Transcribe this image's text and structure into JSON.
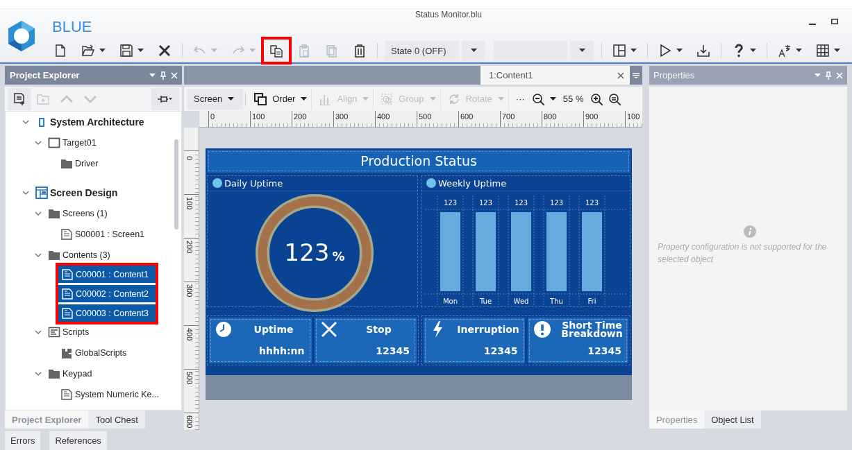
{
  "window": {
    "app_name": "BLUE",
    "title": "Status Monitor.blu"
  },
  "toolbar": [
    [
      {
        "kind": "new",
        "disabled": false,
        "dropdown": false,
        "highlighted": false
      },
      {
        "kind": "open",
        "disabled": false,
        "dropdown": true,
        "highlighted": false
      },
      {
        "kind": "save",
        "disabled": false,
        "dropdown": true,
        "highlighted": false
      },
      {
        "kind": "close",
        "disabled": false,
        "dropdown": false,
        "highlighted": false
      }
    ],
    [
      {
        "kind": "undo",
        "disabled": true,
        "dropdown": true,
        "highlighted": false
      },
      {
        "kind": "redo",
        "disabled": true,
        "dropdown": true,
        "highlighted": false
      },
      {
        "kind": "copy",
        "disabled": false,
        "dropdown": false,
        "highlighted": true
      },
      {
        "kind": "paste",
        "disabled": true,
        "dropdown": false,
        "highlighted": false
      },
      {
        "kind": "duplicate",
        "disabled": true,
        "dropdown": false,
        "highlighted": false
      },
      {
        "kind": "delete",
        "disabled": false,
        "dropdown": false,
        "highlighted": false
      }
    ],
    [
      {
        "kind": "select",
        "value": "State 0 (OFF)",
        "disabled": false,
        "dropdown": true,
        "highlighted": false
      },
      {
        "kind": "select",
        "disabled": false,
        "dropdown": true,
        "highlighted": false
      }
    ],
    [
      {
        "kind": "layout",
        "disabled": false,
        "dropdown": true,
        "highlighted": false
      }
    ],
    [
      {
        "kind": "run",
        "disabled": false,
        "dropdown": true,
        "highlighted": false
      },
      {
        "kind": "download",
        "disabled": false,
        "dropdown": false,
        "highlighted": false
      }
    ],
    [
      {
        "kind": "help",
        "disabled": false,
        "dropdown": true,
        "highlighted": false
      }
    ],
    [
      {
        "kind": "font",
        "disabled": false,
        "dropdown": true,
        "highlighted": false
      },
      {
        "kind": "grid",
        "disabled": false,
        "dropdown": true,
        "highlighted": false
      }
    ]
  ],
  "project_explorer": {
    "title": "Project Explorer",
    "tools": [
      {
        "kind": "new-item",
        "disabled": false
      },
      {
        "kind": "new-folder",
        "disabled": true
      },
      {
        "kind": "up",
        "disabled": true
      },
      {
        "kind": "down",
        "disabled": true
      },
      {
        "kind": "pin",
        "disabled": false
      }
    ],
    "tree": [
      {
        "label": "System Architecture",
        "kind": "system",
        "expanded": true,
        "selected": false,
        "highlighted": false,
        "children": [
          {
            "label": "Target01",
            "kind": "target",
            "expanded": true,
            "selected": false,
            "highlighted": false,
            "children": [
              {
                "label": "Driver",
                "kind": "folder",
                "selected": false,
                "highlighted": false
              }
            ]
          }
        ]
      },
      {
        "label": "Screen Design",
        "kind": "design",
        "expanded": true,
        "selected": false,
        "highlighted": false,
        "children": [
          {
            "label": "Screens (1)",
            "kind": "folder",
            "expanded": true,
            "selected": false,
            "highlighted": false,
            "children": [
              {
                "label": "S00001 : Screen1",
                "kind": "page",
                "selected": false,
                "highlighted": false
              }
            ]
          },
          {
            "label": "Contents (3)",
            "kind": "folder",
            "expanded": true,
            "selected": false,
            "highlighted": false,
            "children": [
              {
                "label": "C00001 : Content1",
                "kind": "page",
                "selected": true,
                "highlighted": true
              },
              {
                "label": "C00002 : Content2",
                "kind": "page",
                "selected": true,
                "highlighted": true
              },
              {
                "label": "C00003 : Content3",
                "kind": "page",
                "selected": true,
                "highlighted": true
              }
            ]
          },
          {
            "label": "Scripts",
            "kind": "scripts",
            "expanded": true,
            "selected": false,
            "highlighted": false,
            "children": [
              {
                "label": "GlobalScripts",
                "kind": "script",
                "selected": false,
                "highlighted": false
              }
            ]
          },
          {
            "label": "Keypad",
            "kind": "folder",
            "expanded": true,
            "selected": false,
            "highlighted": false,
            "children": [
              {
                "label": "System Numeric Ke...",
                "kind": "page",
                "selected": false,
                "highlighted": false
              }
            ]
          }
        ]
      }
    ],
    "tabs": [
      {
        "label": "Project Explorer",
        "selected": true
      },
      {
        "label": "Tool Chest",
        "selected": false
      }
    ]
  },
  "document_tabs": [
    {
      "label": "1:Content1",
      "selected": true
    }
  ],
  "design_toolbar": [
    {
      "kind": "dropdown",
      "label": "Screen",
      "disabled": false
    },
    {
      "kind": "order",
      "label": "Order",
      "disabled": false
    },
    {
      "kind": "align",
      "label": "Align",
      "disabled": true
    },
    {
      "kind": "group",
      "label": "Group",
      "disabled": true
    },
    {
      "kind": "rotate",
      "label": "Rotate",
      "disabled": true
    },
    {
      "kind": "more",
      "label": "···",
      "disabled": false
    },
    {
      "kind": "zoom-out",
      "disabled": false
    },
    {
      "kind": "zoom-level",
      "label": "55 %",
      "disabled": false
    },
    {
      "kind": "zoom-in",
      "disabled": false
    },
    {
      "kind": "zoom-fit",
      "disabled": false
    }
  ],
  "ruler": {
    "horizontal": [
      "0",
      "100",
      "200",
      "300",
      "400",
      "500",
      "600",
      "700",
      "800",
      "900",
      "100"
    ],
    "vertical": [
      "0",
      "100",
      "200",
      "300",
      "400",
      "500",
      "600"
    ]
  },
  "screen": {
    "title": "Production Status",
    "daily": {
      "title": "Daily Uptime",
      "value": "123",
      "unit": "%"
    },
    "weekly": {
      "title": "Weekly Uptime",
      "chart_data": {
        "type": "bar",
        "categories": [
          "Mon",
          "Tue",
          "Wed",
          "Thu",
          "Fri"
        ],
        "values": [
          123,
          123,
          123,
          123,
          123
        ],
        "data_labels": true
      }
    },
    "stats": [
      {
        "kind": "clock",
        "label": "Uptime",
        "value": "hhhh:nn"
      },
      {
        "kind": "cross",
        "label": "Stop",
        "value": "12345"
      },
      {
        "kind": "bolt",
        "label": "Inerruption",
        "value": "12345"
      },
      {
        "kind": "alert",
        "label": "Short Time Breakdown",
        "value": "12345"
      }
    ]
  },
  "properties": {
    "title": "Properties",
    "message": "Property configuration is not supported for the selected object",
    "tabs": [
      {
        "label": "Properties",
        "selected": true
      },
      {
        "label": "Object List",
        "selected": false
      }
    ]
  },
  "bottom_tabs": [
    {
      "label": "Errors",
      "selected": false
    },
    {
      "label": "References",
      "selected": false
    }
  ]
}
